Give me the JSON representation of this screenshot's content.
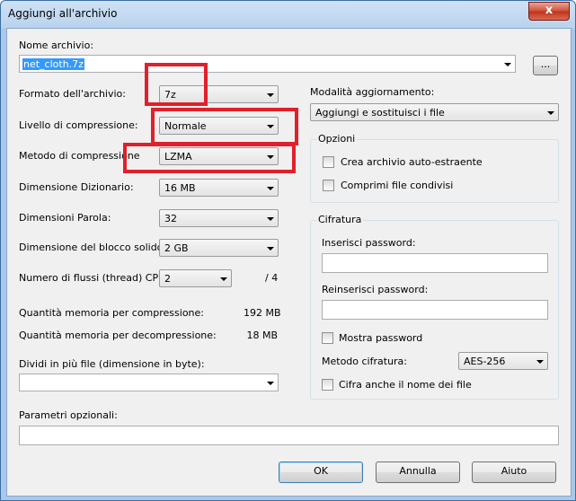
{
  "window": {
    "title": "Aggiungi all'archivio",
    "close_label": "x"
  },
  "archive": {
    "label": "Nome archivio:",
    "value": "net_cloth.7z",
    "browse_label": "..."
  },
  "left": {
    "format": {
      "label": "Formato dell'archivio:",
      "value": "7z"
    },
    "level": {
      "label": "Livello di compressione:",
      "value": "Normale"
    },
    "method": {
      "label": "Metodo di compressione",
      "value": "LZMA"
    },
    "dict": {
      "label": "Dimensione Dizionario:",
      "value": "16 MB"
    },
    "word": {
      "label": "Dimensioni Parola:",
      "value": "32"
    },
    "solid": {
      "label": "Dimensione del blocco solido:",
      "value": "2 GB"
    },
    "threads": {
      "label": "Numero di flussi (thread) CPU:",
      "value": "2",
      "max": "/ 4"
    },
    "mem_comp": {
      "label": "Quantità memoria per compressione:",
      "value": "192 MB"
    },
    "mem_decomp": {
      "label": "Quantità memoria per decompressione:",
      "value": "18 MB"
    },
    "split": {
      "label": "Dividi in più file (dimensione in byte):",
      "value": ""
    }
  },
  "right": {
    "update": {
      "label": "Modalità aggiornamento:",
      "value": "Aggiungi e sostituisci i file"
    },
    "options": {
      "title": "Opzioni",
      "sfx": "Crea archivio auto-estraente",
      "shared": "Comprimi file condivisi"
    },
    "encryption": {
      "title": "Cifratura",
      "pw_label": "Inserisci password:",
      "pw2_label": "Reinserisci password:",
      "show_pw": "Mostra password",
      "method_label": "Metodo cifratura:",
      "method_value": "AES-256",
      "encrypt_names": "Cifra anche il nome dei file"
    }
  },
  "params": {
    "label": "Parametri opzionali:",
    "value": ""
  },
  "buttons": {
    "ok": "OK",
    "cancel": "Annulla",
    "help": "Aiuto"
  },
  "colors": {
    "highlight_boxes": "#e0202a",
    "selection": "#3399ff"
  }
}
